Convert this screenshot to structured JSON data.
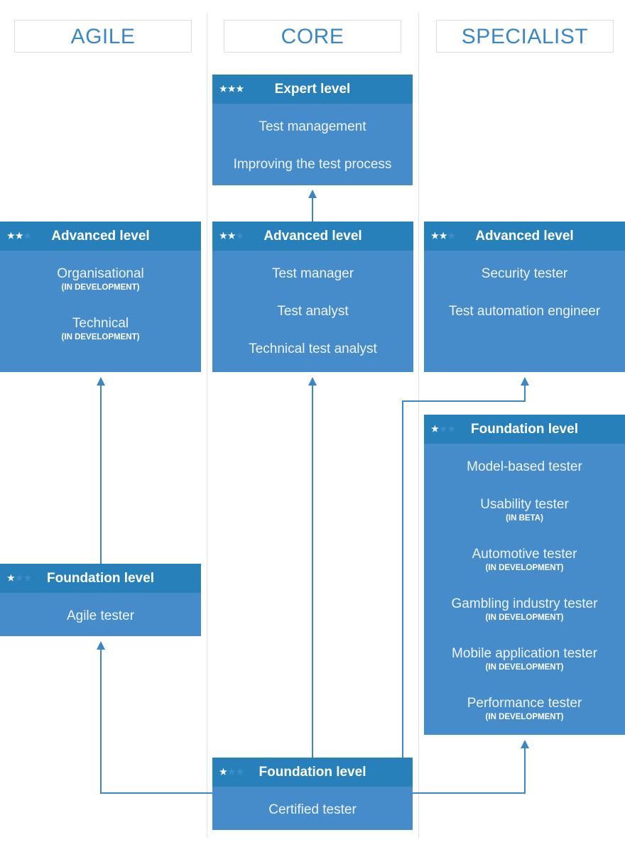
{
  "columns": [
    {
      "title": "AGILE"
    },
    {
      "title": "CORE"
    },
    {
      "title": "SPECIALIST"
    }
  ],
  "colors": {
    "header": "#2880ba",
    "body": "#468bca",
    "line": "#3b86c6"
  },
  "boxes": {
    "core_expert": {
      "level": "Expert level",
      "stars": 3,
      "items": [
        {
          "label": "Test management"
        },
        {
          "label": "Improving the test process"
        }
      ]
    },
    "agile_advanced": {
      "level": "Advanced level",
      "stars": 2,
      "items": [
        {
          "label": "Organisational",
          "note": "(IN DEVELOPMENT)"
        },
        {
          "label": "Technical",
          "note": "(IN DEVELOPMENT)"
        }
      ]
    },
    "core_advanced": {
      "level": "Advanced level",
      "stars": 2,
      "items": [
        {
          "label": "Test manager"
        },
        {
          "label": "Test analyst"
        },
        {
          "label": "Technical test analyst"
        }
      ]
    },
    "specialist_advanced": {
      "level": "Advanced level",
      "stars": 2,
      "items": [
        {
          "label": "Security tester"
        },
        {
          "label": "Test automation engineer"
        }
      ]
    },
    "specialist_foundation": {
      "level": "Foundation level",
      "stars": 1,
      "items": [
        {
          "label": "Model-based tester"
        },
        {
          "label": "Usability tester",
          "note": "(IN BETA)"
        },
        {
          "label": "Automotive tester",
          "note": "(IN DEVELOPMENT)"
        },
        {
          "label": "Gambling industry tester",
          "note": "(IN DEVELOPMENT)"
        },
        {
          "label": "Mobile application tester",
          "note": "(IN DEVELOPMENT)"
        },
        {
          "label": "Performance tester",
          "note": "(IN DEVELOPMENT)"
        }
      ]
    },
    "agile_foundation": {
      "level": "Foundation level",
      "stars": 1,
      "items": [
        {
          "label": "Agile tester"
        }
      ]
    },
    "core_foundation": {
      "level": "Foundation level",
      "stars": 1,
      "items": [
        {
          "label": "Certified tester"
        }
      ]
    }
  }
}
